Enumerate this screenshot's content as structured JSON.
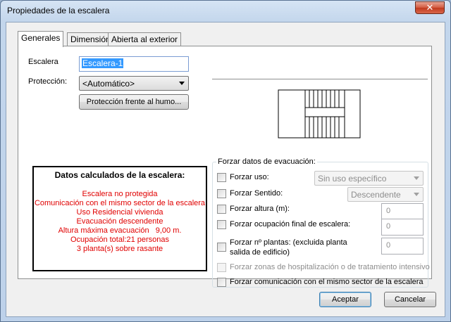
{
  "window": {
    "title": "Propiedades de la escalera",
    "close_glyph": "✕"
  },
  "tabs": [
    {
      "label": "Generales",
      "active": true
    },
    {
      "label": "Dimensión",
      "active": false
    },
    {
      "label": "Abierta al exterior",
      "active": false
    }
  ],
  "general": {
    "escalera_label": "Escalera",
    "escalera_value": "Escalera-1",
    "proteccion_label": "Protección:",
    "proteccion_value": "<Automático>",
    "humo_button": "Protección frente al humo..."
  },
  "calc": {
    "title": "Datos calculados de la escalera:",
    "lines": [
      "Escalera no protegida",
      "Comunicación con el mismo sector de la escalera",
      "Uso Residencial vivienda",
      "Evacuación descendente",
      "Altura máxima evacuación   9,00 m.",
      "Ocupación total:21 personas",
      "3 planta(s) sobre rasante"
    ],
    "color": "#e00000"
  },
  "forzar": {
    "title": "Forzar datos de evacuación:",
    "uso_label": "Forzar uso:",
    "uso_value": "Sin uso específico",
    "sentido_label": "Forzar Sentido:",
    "sentido_value": "Descendente",
    "altura_label": "Forzar altura (m):",
    "altura_value": "0",
    "ocupacion_label": "Forzar ocupación final de escalera:",
    "ocupacion_value": "0",
    "plantas_label_1": "Forzar nº plantas: (excluida planta",
    "plantas_label_2": "salida de edificio)",
    "plantas_value": "0",
    "zonas_label": "Forzar zonas de hospitalización o de tratamiento intensivo",
    "comunicacion_label": "Forzar comunicación con el mismo sector de la escalera"
  },
  "footer": {
    "accept": "Aceptar",
    "cancel": "Cancelar"
  }
}
